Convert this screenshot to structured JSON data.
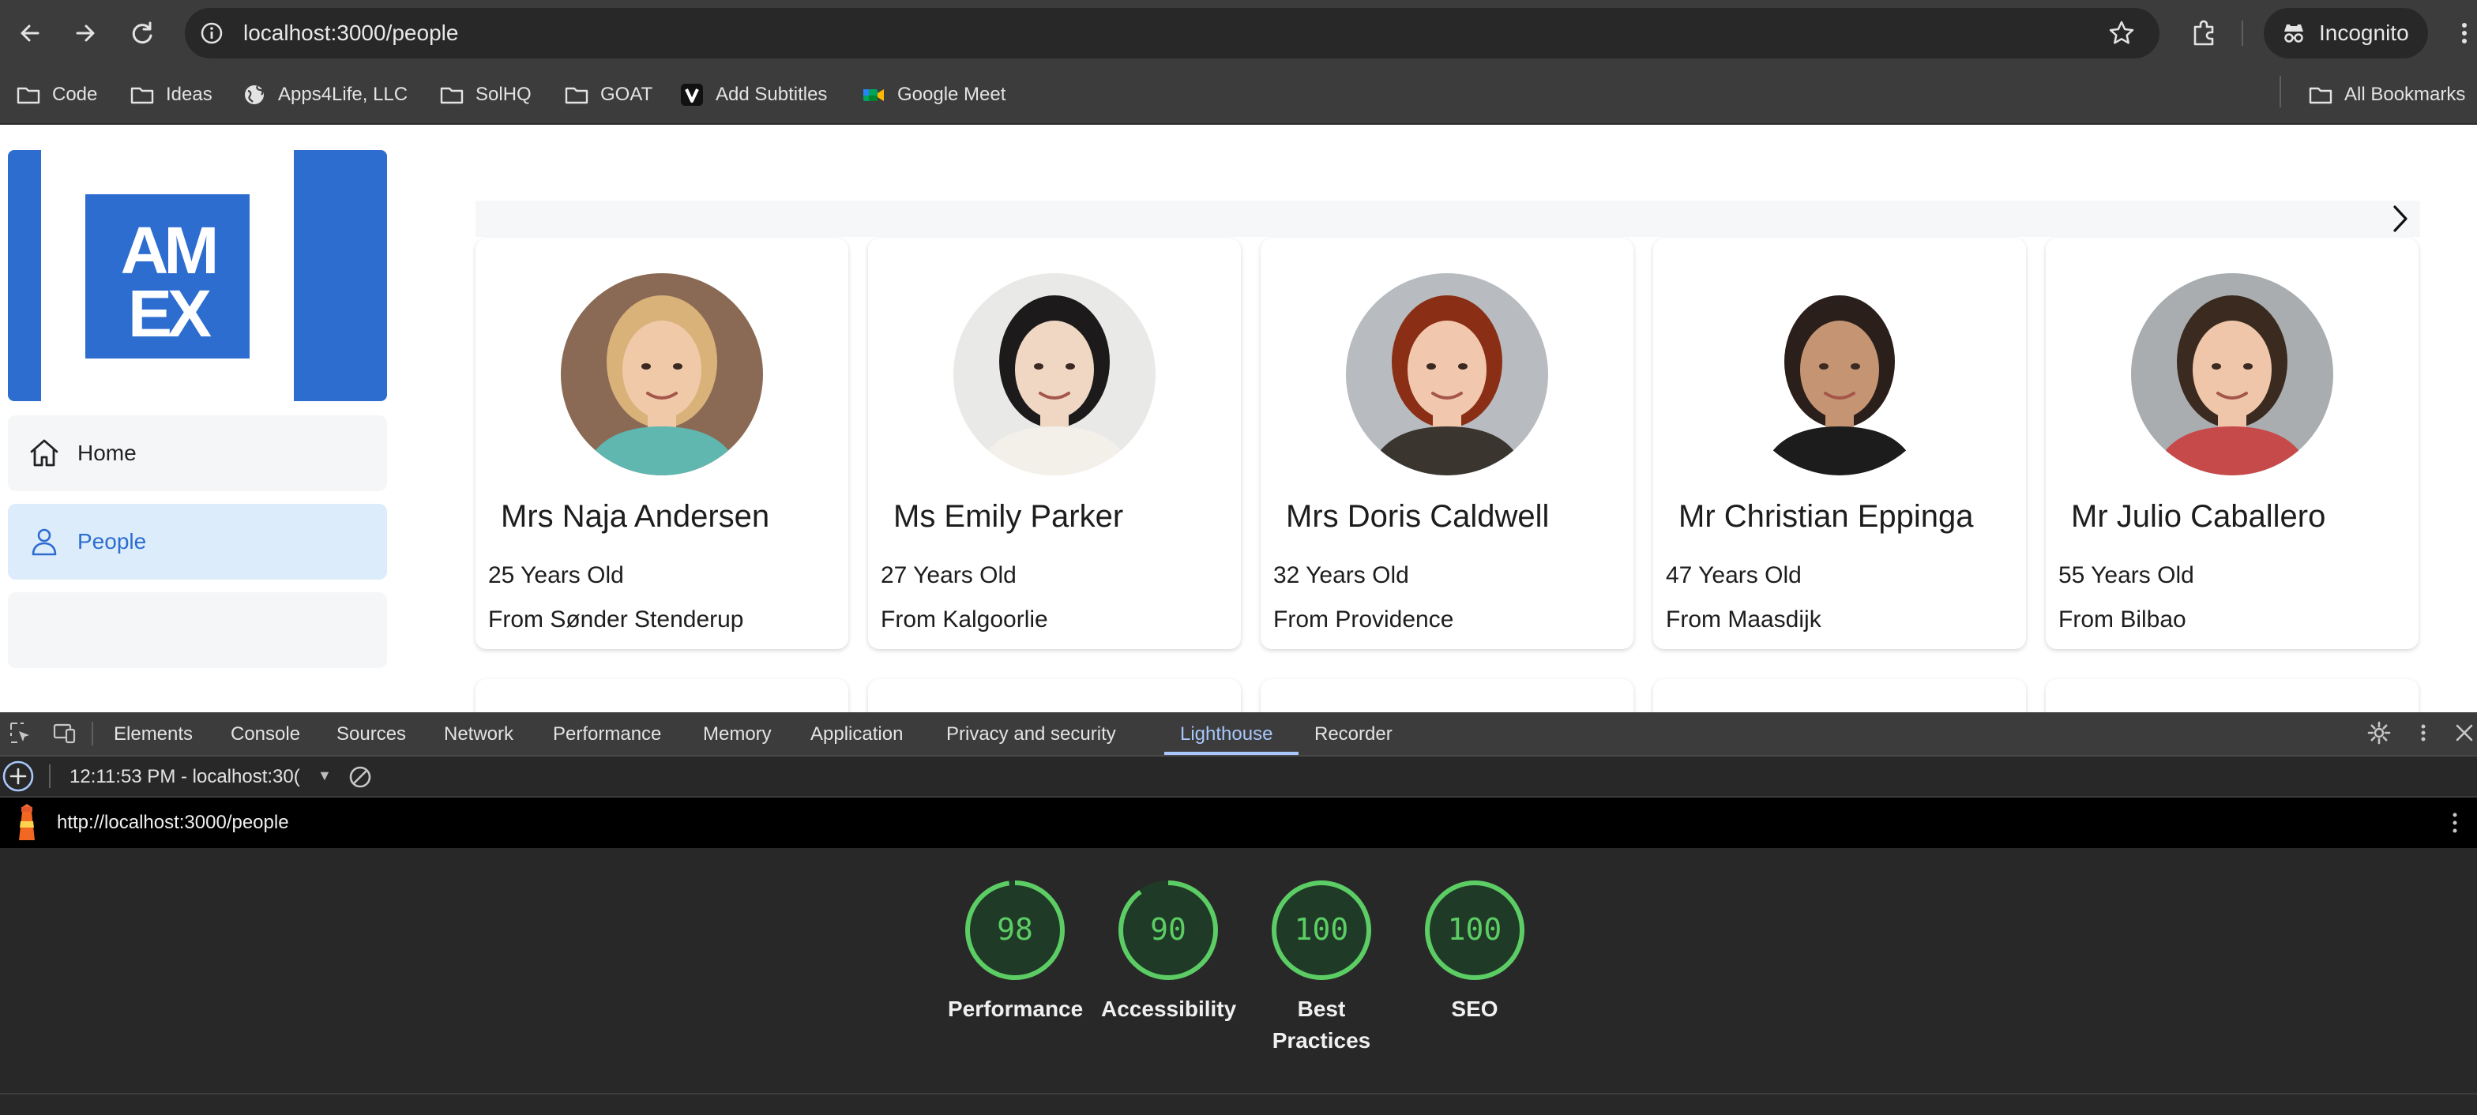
{
  "browser": {
    "url": "localhost:3000/people",
    "incognito_label": "Incognito",
    "bookmarks": [
      {
        "label": "Code",
        "icon": "folder-icon"
      },
      {
        "label": "Ideas",
        "icon": "folder-icon"
      },
      {
        "label": "Apps4Life, LLC",
        "icon": "globe-icon"
      },
      {
        "label": "SolHQ",
        "icon": "folder-icon"
      },
      {
        "label": "GOAT",
        "icon": "folder-icon"
      },
      {
        "label": "Add Subtitles",
        "icon": "v-logo-icon"
      },
      {
        "label": "Google Meet",
        "icon": "google-meet-icon"
      }
    ],
    "all_bookmarks_label": "All Bookmarks"
  },
  "sidebar": {
    "logo": {
      "lines": [
        "AM",
        "EX"
      ],
      "color": "#2d6dd0"
    },
    "items": [
      {
        "label": "Home",
        "icon": "home-icon",
        "active": false
      },
      {
        "label": "People",
        "icon": "person-icon",
        "active": true
      }
    ]
  },
  "people": [
    {
      "name": "Mrs Naja Andersen",
      "age": "25 Years Old",
      "from": "From Sønder Stenderup",
      "photo": {
        "bg": "#8a6a55",
        "hair": "#d9b27a",
        "skin": "#f0c9a8",
        "shirt": "#5fb7b0"
      }
    },
    {
      "name": "Ms Emily Parker",
      "age": "27 Years Old",
      "from": "From Kalgoorlie",
      "photo": {
        "bg": "#e9e9e7",
        "hair": "#1c1a1a",
        "skin": "#efd7c4",
        "shirt": "#f3f0ea"
      }
    },
    {
      "name": "Mrs Doris Caldwell",
      "age": "32 Years Old",
      "from": "From Providence",
      "photo": {
        "bg": "#b8bcc0",
        "hair": "#8a2f16",
        "skin": "#f1c8ae",
        "shirt": "#3b3530"
      }
    },
    {
      "name": "Mr Christian Eppinga",
      "age": "47 Years Old",
      "from": "From Maasdijk",
      "photo": {
        "bg": "#ffffff",
        "hair": "#2a1f1a",
        "skin": "#c59473",
        "shirt": "#1c1c1c"
      }
    },
    {
      "name": "Mr Julio Caballero",
      "age": "55 Years Old",
      "from": "From Bilbao",
      "photo": {
        "bg": "#a9adb0",
        "hair": "#3b2a1f",
        "skin": "#efc6aa",
        "shirt": "#c74a4a"
      }
    }
  ],
  "devtools": {
    "tabs": [
      "Elements",
      "Console",
      "Sources",
      "Network",
      "Performance",
      "Memory",
      "Application",
      "Privacy and security",
      "Lighthouse",
      "Recorder"
    ],
    "active_tab": "Lighthouse",
    "report_select": "12:11:53 PM - localhost:30(",
    "report_url": "http://localhost:3000/people",
    "scores": [
      {
        "value": 98,
        "label_lines": [
          "Performance"
        ],
        "color": "#5ccd64"
      },
      {
        "value": 90,
        "label_lines": [
          "Accessibility"
        ],
        "color": "#5ccd64"
      },
      {
        "value": 100,
        "label_lines": [
          "Best",
          "Practices"
        ],
        "color": "#5ccd64"
      },
      {
        "value": 100,
        "label_lines": [
          "SEO"
        ],
        "color": "#5ccd64"
      }
    ]
  }
}
